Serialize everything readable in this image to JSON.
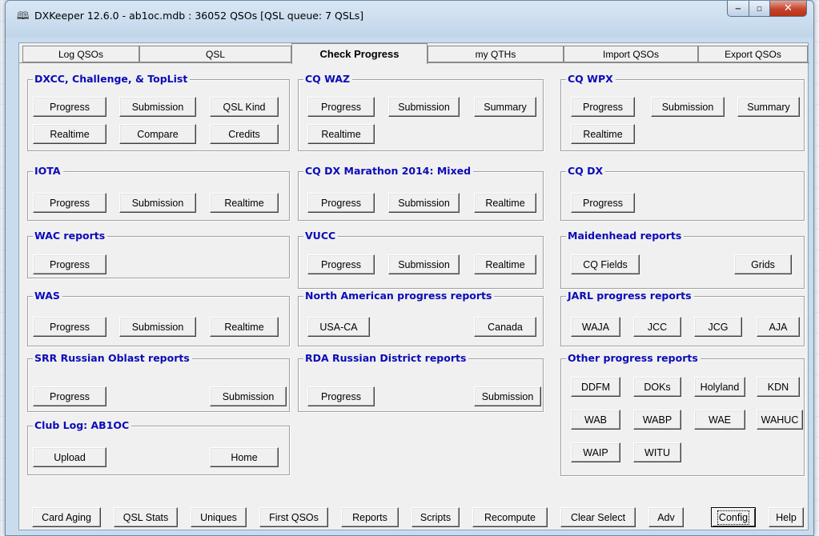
{
  "window": {
    "title": "DXKeeper 12.6.0 - ab1oc.mdb : 36052 QSOs [QSL queue: 7 QSLs]"
  },
  "tabs": [
    {
      "label": "Log QSOs"
    },
    {
      "label": "QSL"
    },
    {
      "label": "Check Progress",
      "active": true
    },
    {
      "label": "my QTHs"
    },
    {
      "label": "Import QSOs"
    },
    {
      "label": "Export QSOs"
    }
  ],
  "groups": {
    "dxcc": {
      "title": "DXCC, Challenge, & TopList",
      "buttons": [
        "Progress",
        "Submission",
        "QSL Kind",
        "Realtime",
        "Compare",
        "Credits"
      ]
    },
    "cqwaz": {
      "title": "CQ WAZ",
      "buttons": [
        "Progress",
        "Submission",
        "Summary",
        "Realtime"
      ]
    },
    "cqwpx": {
      "title": "CQ WPX",
      "buttons": [
        "Progress",
        "Submission",
        "Summary",
        "Realtime"
      ]
    },
    "iota": {
      "title": "IOTA",
      "buttons": [
        "Progress",
        "Submission",
        "Realtime"
      ]
    },
    "marathon": {
      "title": "CQ DX Marathon 2014: Mixed",
      "buttons": [
        "Progress",
        "Submission",
        "Realtime"
      ]
    },
    "cqdx": {
      "title": "CQ DX",
      "buttons": [
        "Progress"
      ]
    },
    "wac": {
      "title": "WAC reports",
      "buttons": [
        "Progress"
      ]
    },
    "vucc": {
      "title": "VUCC",
      "buttons": [
        "Progress",
        "Submission",
        "Realtime"
      ]
    },
    "maidenhead": {
      "title": "Maidenhead reports",
      "buttons": [
        "CQ Fields",
        "Grids"
      ]
    },
    "was": {
      "title": "WAS",
      "buttons": [
        "Progress",
        "Submission",
        "Realtime"
      ]
    },
    "northam": {
      "title": "North American progress reports",
      "buttons": [
        "USA-CA",
        "Canada"
      ]
    },
    "jarl": {
      "title": "JARL progress reports",
      "buttons": [
        "WAJA",
        "JCC",
        "JCG",
        "AJA"
      ]
    },
    "srr": {
      "title": "SRR Russian Oblast reports",
      "buttons": [
        "Progress",
        "Submission"
      ]
    },
    "rda": {
      "title": "RDA Russian District reports",
      "buttons": [
        "Progress",
        "Submission"
      ]
    },
    "other": {
      "title": "Other progress reports",
      "buttons": [
        "DDFM",
        "DOKs",
        "Holyland",
        "KDN",
        "WAB",
        "WABP",
        "WAE",
        "WAHUC",
        "WAIP",
        "WITU"
      ]
    },
    "clublog": {
      "title": "Club Log: AB1OC",
      "buttons": [
        "Upload",
        "Home"
      ]
    }
  },
  "bottom_buttons": [
    "Card Aging",
    "QSL Stats",
    "Uniques",
    "First QSOs",
    "Reports",
    "Scripts",
    "Recompute",
    "Clear Select",
    "Adv",
    "Config",
    "Help"
  ],
  "focused_button": "Config"
}
